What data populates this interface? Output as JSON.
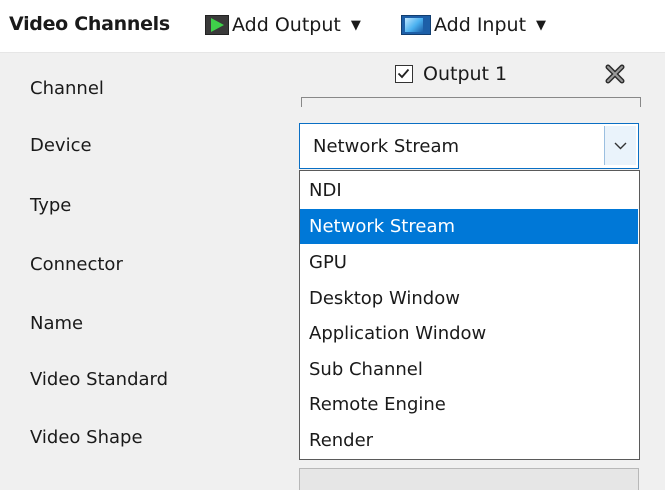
{
  "toolbar": {
    "title": "Video Channels",
    "add_output_label": "Add Output",
    "add_input_label": "Add Input",
    "caret": "▼"
  },
  "rows": {
    "channel": "Channel",
    "device": "Device",
    "type": "Type",
    "connector": "Connector",
    "name": "Name",
    "video_standard": "Video Standard",
    "video_shape": "Video Shape"
  },
  "output": {
    "label": "Output 1",
    "checked": true
  },
  "device_select": {
    "value": "Network Stream"
  },
  "dropdown": {
    "options": [
      "NDI",
      "Network Stream",
      "GPU",
      "Desktop Window",
      "Application Window",
      "Sub Channel",
      "Remote Engine",
      "Render"
    ],
    "selected_index": 1
  },
  "colors": {
    "selection": "#0078d7",
    "focus_border": "#0a6fc4",
    "output_icon_green": "#3fd14a",
    "input_icon_blue": "#1d5fa8"
  },
  "icons": {
    "add_output": "add-output-icon",
    "add_input": "add-input-icon",
    "remove": "remove-output-icon",
    "checkbox": "checkbox-checked-icon",
    "select_arrow": "chevron-down-icon"
  }
}
